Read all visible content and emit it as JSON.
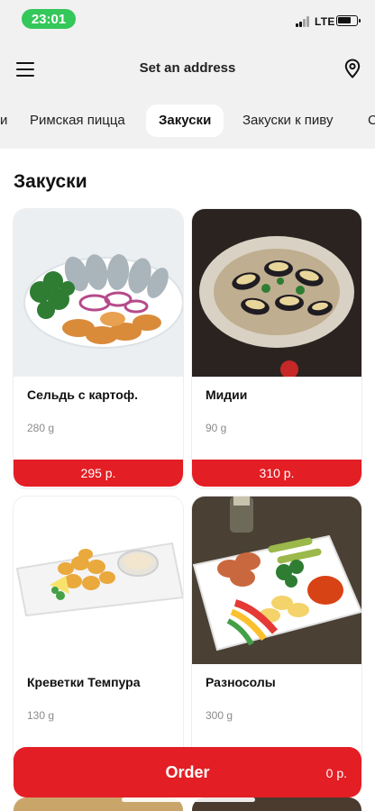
{
  "status_bar": {
    "time": "23:01",
    "network": "LTE"
  },
  "header": {
    "title": "Set an address",
    "menu_icon": "hamburger-menu-icon",
    "location_icon": "map-pin-icon"
  },
  "tabs": [
    {
      "label": "и",
      "active": false
    },
    {
      "label": "Римская пицца",
      "active": false
    },
    {
      "label": "Закуски",
      "active": true
    },
    {
      "label": "Закуски к пиву",
      "active": false
    },
    {
      "label": "С",
      "active": false
    }
  ],
  "section": {
    "title": "Закуски"
  },
  "products": [
    {
      "name": "Сельдь с картоф.",
      "weight": "280 g",
      "price": "295 р."
    },
    {
      "name": "Мидии",
      "weight": "90 g",
      "price": "310 р."
    },
    {
      "name": "Креветки Темпура",
      "weight": "130 g",
      "price": ""
    },
    {
      "name": "Разносолы",
      "weight": "300 g",
      "price": ""
    }
  ],
  "order_bar": {
    "label": "Order",
    "total": "0 р."
  },
  "colors": {
    "accent": "#e31e24",
    "status_green": "#34c759",
    "top_background": "#f1f1f1"
  }
}
